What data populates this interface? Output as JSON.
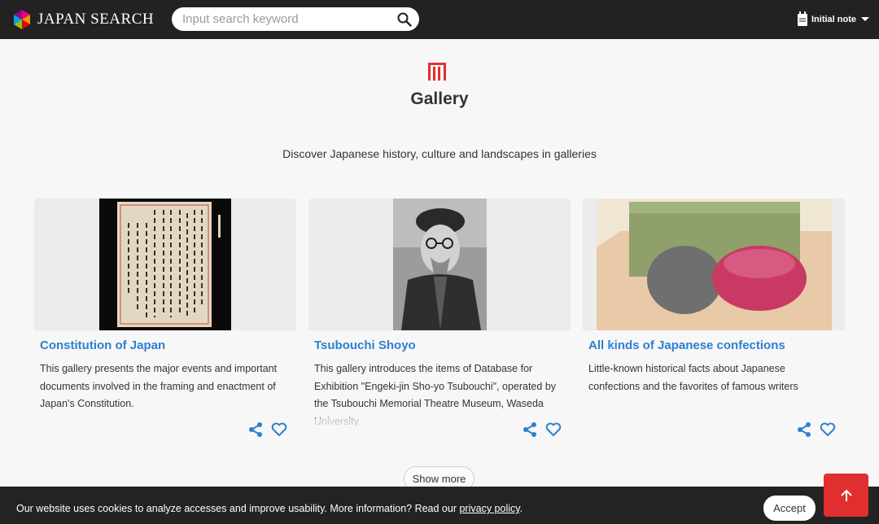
{
  "header": {
    "logo_text": "JAPAN SEARCH",
    "search_placeholder": "Input search keyword",
    "note_label": "Initial note"
  },
  "hero": {
    "title": "Gallery",
    "subtitle": "Discover Japanese history, culture and landscapes  in galleries"
  },
  "cards": [
    {
      "title": "Constitution of Japan",
      "description": "This gallery presents the major events and important documents involved in the framing and enactment of Japan's Constitution."
    },
    {
      "title": "Tsubouchi Shoyo",
      "description": "This gallery introduces the items of Database for Exhibition \"Engeki-jin Sho-yo Tsubouchi\", operated by the Tsubouchi Memorial Theatre Museum, Waseda University."
    },
    {
      "title": "All kinds of Japanese confections",
      "description": "Little-known historical facts about Japanese confections and the favorites of famous writers"
    }
  ],
  "show_more_label": "Show more",
  "cookie": {
    "text": "Our website uses cookies to analyze accesses and improve usability. More information? Read our ",
    "link_text": "privacy policy",
    "suffix": ".",
    "accept_label": "Accept"
  },
  "colors": {
    "header_bg": "#222222",
    "accent_red": "#e12f2f",
    "link_blue": "#2f7fd0"
  },
  "icons": [
    "logo-mark-icon",
    "search-icon",
    "note-icon",
    "gallery-icon",
    "share-icon",
    "heart-icon",
    "arrow-up-icon"
  ]
}
